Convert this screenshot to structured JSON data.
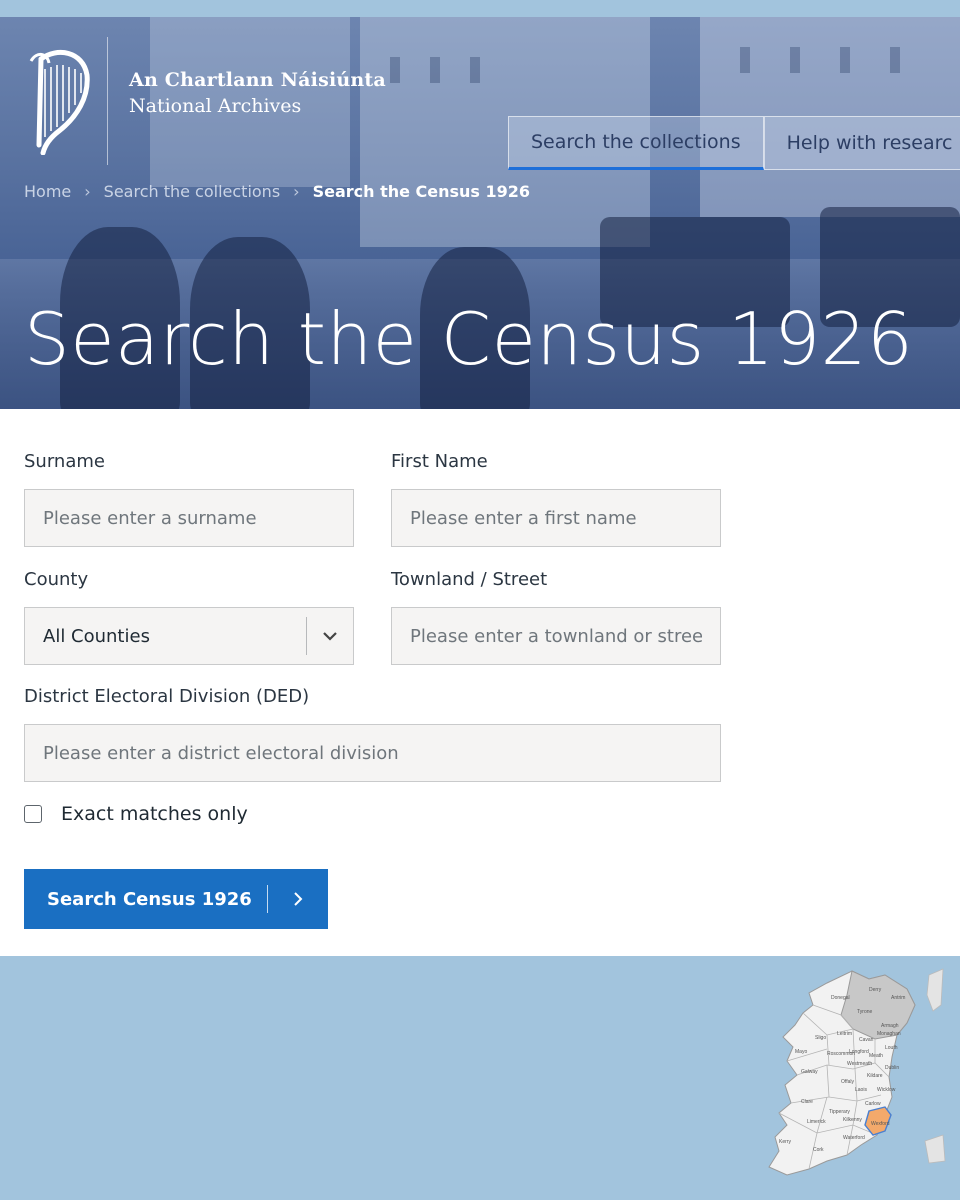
{
  "header": {
    "brand_line_1": "An Chartlann Náisiúnta",
    "brand_line_2": "National Archives",
    "nav": [
      {
        "label": "Search the collections"
      },
      {
        "label": "Help with researc"
      }
    ]
  },
  "breadcrumb": [
    {
      "label": "Home"
    },
    {
      "label": "Search the collections"
    },
    {
      "label": "Search the Census 1926"
    }
  ],
  "page_title": "Search the Census 1926",
  "form": {
    "surname": {
      "label": "Surname",
      "placeholder": "Please enter a surname",
      "value": ""
    },
    "first_name": {
      "label": "First Name",
      "placeholder": "Please enter a first name",
      "value": ""
    },
    "county": {
      "label": "County",
      "selected": "All Counties"
    },
    "townland": {
      "label": "Townland / Street",
      "placeholder": "Please enter a townland or street",
      "value": ""
    },
    "ded": {
      "label": "District Electoral Division (DED)",
      "placeholder": "Please enter a district electoral division",
      "value": ""
    },
    "exact_match": {
      "label": "Exact matches only",
      "checked": false
    },
    "submit_label": "Search Census 1926"
  },
  "map": {
    "counties": [
      "Donegal",
      "Derry",
      "Antrim",
      "Tyrone",
      "Armagh",
      "Sligo",
      "Leitrim",
      "Cavan",
      "Monaghan",
      "Mayo",
      "Roscommon",
      "Longford",
      "Louth",
      "Galway",
      "Westmeath",
      "Meath",
      "Offaly",
      "Kildare",
      "Dublin",
      "Laois",
      "Wicklow",
      "Clare",
      "Tipperary",
      "Carlow",
      "Limerick",
      "Kilkenny",
      "Wexford",
      "Waterford",
      "Cork",
      "Kerry"
    ],
    "highlighted": "Wexford",
    "highlight_color": "#f3a96b"
  },
  "colors": {
    "page_background": "#a2c4dd",
    "primary_button": "#1a6fc2",
    "hero_overlay": "#3f5b8f"
  }
}
